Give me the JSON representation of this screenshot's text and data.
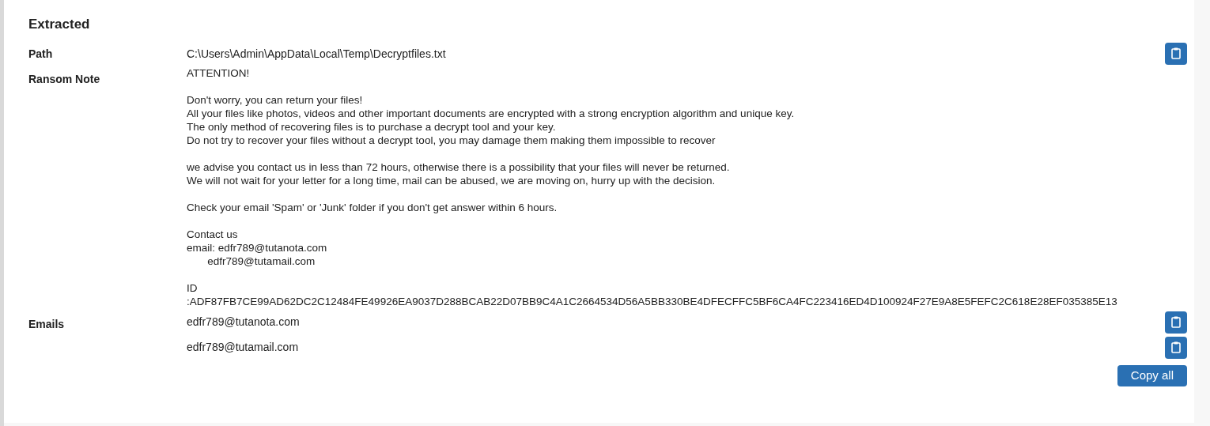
{
  "section": {
    "title": "Extracted"
  },
  "path": {
    "label": "Path",
    "value": "C:\\Users\\Admin\\AppData\\Local\\Temp\\Decryptfiles.txt"
  },
  "ransom_note": {
    "label": "Ransom Note",
    "paragraphs": [
      [
        "ATTENTION!"
      ],
      [
        "Don't worry, you can return your files!",
        "All your files like photos, videos and other important documents are encrypted with a strong encryption algorithm and unique key.",
        "The only method of recovering files is to purchase a decrypt tool and your key.",
        "Do not try to recover your files without a decrypt tool, you may damage them making them impossible to recover"
      ],
      [
        "we advise you contact us in less than 72 hours, otherwise there is a possibility that your files will never be returned.",
        "We will not wait for your letter for a long time, mail can be abused, we are moving on, hurry up with the decision."
      ],
      [
        "Check your email 'Spam' or 'Junk' folder if you don't get answer within 6 hours."
      ],
      [
        "Contact us",
        "email: edfr789@tutanota.com",
        "       edfr789@tutamail.com"
      ],
      [
        "ID",
        ":ADF87FB7CE99AD62DC2C12484FE49926EA9037D288BCAB22D07BB9C4A1C2664534D56A5BB330BE4DFECFFC5BF6CA4FC223416ED4D100924F27E9A8E5FEFC2C618E28EF035385E13"
      ]
    ]
  },
  "emails": {
    "label": "Emails",
    "items": [
      "edfr789@tutanota.com",
      "edfr789@tutamail.com"
    ]
  },
  "copy_all": "Copy all"
}
